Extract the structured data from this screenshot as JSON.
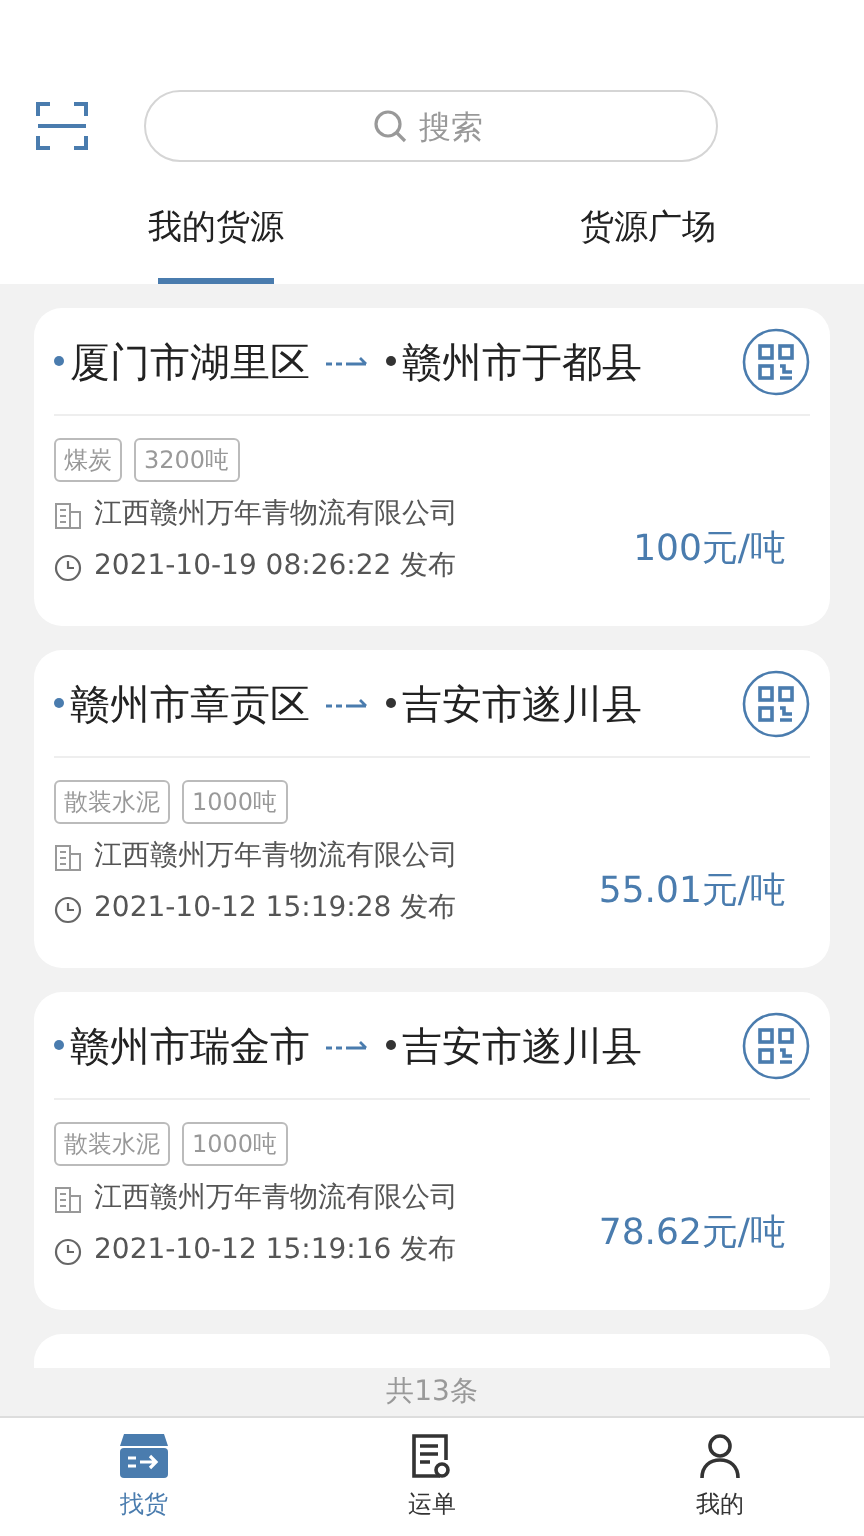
{
  "header": {
    "search": {
      "placeholder": "搜索"
    }
  },
  "tabs": [
    {
      "label": "我的货源",
      "selected": true
    },
    {
      "label": "货源广场",
      "selected": false
    }
  ],
  "cards": [
    {
      "from": "厦门市湖里区",
      "to": "赣州市于都县",
      "tags": [
        "煤炭",
        "3200吨"
      ],
      "company": "江西赣州万年青物流有限公司",
      "time": "2021-10-19 08:26:22 发布",
      "price": "100元/吨"
    },
    {
      "from": "赣州市章贡区",
      "to": "吉安市遂川县",
      "tags": [
        "散装水泥",
        "1000吨"
      ],
      "company": "江西赣州万年青物流有限公司",
      "time": "2021-10-12 15:19:28 发布",
      "price": "55.01元/吨"
    },
    {
      "from": "赣州市瑞金市",
      "to": "吉安市遂川县",
      "tags": [
        "散装水泥",
        "1000吨"
      ],
      "company": "江西赣州万年青物流有限公司",
      "time": "2021-10-12 15:19:16 发布",
      "price": "78.62元/吨"
    }
  ],
  "total": "共13条",
  "bottom_nav": [
    {
      "label": "找货",
      "kind": "box",
      "selected": true
    },
    {
      "label": "运单",
      "kind": "list",
      "selected": false
    },
    {
      "label": "我的",
      "kind": "person",
      "selected": false
    }
  ]
}
